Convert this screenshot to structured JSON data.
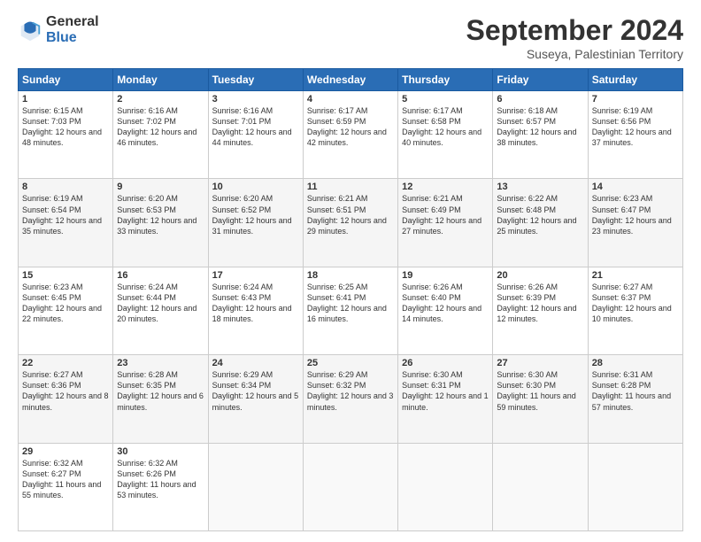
{
  "header": {
    "logo_general": "General",
    "logo_blue": "Blue",
    "month_title": "September 2024",
    "subtitle": "Suseya, Palestinian Territory"
  },
  "weekdays": [
    "Sunday",
    "Monday",
    "Tuesday",
    "Wednesday",
    "Thursday",
    "Friday",
    "Saturday"
  ],
  "weeks": [
    [
      {
        "day": "1",
        "sunrise": "6:15 AM",
        "sunset": "7:03 PM",
        "daylight": "12 hours and 48 minutes."
      },
      {
        "day": "2",
        "sunrise": "6:16 AM",
        "sunset": "7:02 PM",
        "daylight": "12 hours and 46 minutes."
      },
      {
        "day": "3",
        "sunrise": "6:16 AM",
        "sunset": "7:01 PM",
        "daylight": "12 hours and 44 minutes."
      },
      {
        "day": "4",
        "sunrise": "6:17 AM",
        "sunset": "6:59 PM",
        "daylight": "12 hours and 42 minutes."
      },
      {
        "day": "5",
        "sunrise": "6:17 AM",
        "sunset": "6:58 PM",
        "daylight": "12 hours and 40 minutes."
      },
      {
        "day": "6",
        "sunrise": "6:18 AM",
        "sunset": "6:57 PM",
        "daylight": "12 hours and 38 minutes."
      },
      {
        "day": "7",
        "sunrise": "6:19 AM",
        "sunset": "6:56 PM",
        "daylight": "12 hours and 37 minutes."
      }
    ],
    [
      {
        "day": "8",
        "sunrise": "6:19 AM",
        "sunset": "6:54 PM",
        "daylight": "12 hours and 35 minutes."
      },
      {
        "day": "9",
        "sunrise": "6:20 AM",
        "sunset": "6:53 PM",
        "daylight": "12 hours and 33 minutes."
      },
      {
        "day": "10",
        "sunrise": "6:20 AM",
        "sunset": "6:52 PM",
        "daylight": "12 hours and 31 minutes."
      },
      {
        "day": "11",
        "sunrise": "6:21 AM",
        "sunset": "6:51 PM",
        "daylight": "12 hours and 29 minutes."
      },
      {
        "day": "12",
        "sunrise": "6:21 AM",
        "sunset": "6:49 PM",
        "daylight": "12 hours and 27 minutes."
      },
      {
        "day": "13",
        "sunrise": "6:22 AM",
        "sunset": "6:48 PM",
        "daylight": "12 hours and 25 minutes."
      },
      {
        "day": "14",
        "sunrise": "6:23 AM",
        "sunset": "6:47 PM",
        "daylight": "12 hours and 23 minutes."
      }
    ],
    [
      {
        "day": "15",
        "sunrise": "6:23 AM",
        "sunset": "6:45 PM",
        "daylight": "12 hours and 22 minutes."
      },
      {
        "day": "16",
        "sunrise": "6:24 AM",
        "sunset": "6:44 PM",
        "daylight": "12 hours and 20 minutes."
      },
      {
        "day": "17",
        "sunrise": "6:24 AM",
        "sunset": "6:43 PM",
        "daylight": "12 hours and 18 minutes."
      },
      {
        "day": "18",
        "sunrise": "6:25 AM",
        "sunset": "6:41 PM",
        "daylight": "12 hours and 16 minutes."
      },
      {
        "day": "19",
        "sunrise": "6:26 AM",
        "sunset": "6:40 PM",
        "daylight": "12 hours and 14 minutes."
      },
      {
        "day": "20",
        "sunrise": "6:26 AM",
        "sunset": "6:39 PM",
        "daylight": "12 hours and 12 minutes."
      },
      {
        "day": "21",
        "sunrise": "6:27 AM",
        "sunset": "6:37 PM",
        "daylight": "12 hours and 10 minutes."
      }
    ],
    [
      {
        "day": "22",
        "sunrise": "6:27 AM",
        "sunset": "6:36 PM",
        "daylight": "12 hours and 8 minutes."
      },
      {
        "day": "23",
        "sunrise": "6:28 AM",
        "sunset": "6:35 PM",
        "daylight": "12 hours and 6 minutes."
      },
      {
        "day": "24",
        "sunrise": "6:29 AM",
        "sunset": "6:34 PM",
        "daylight": "12 hours and 5 minutes."
      },
      {
        "day": "25",
        "sunrise": "6:29 AM",
        "sunset": "6:32 PM",
        "daylight": "12 hours and 3 minutes."
      },
      {
        "day": "26",
        "sunrise": "6:30 AM",
        "sunset": "6:31 PM",
        "daylight": "12 hours and 1 minute."
      },
      {
        "day": "27",
        "sunrise": "6:30 AM",
        "sunset": "6:30 PM",
        "daylight": "11 hours and 59 minutes."
      },
      {
        "day": "28",
        "sunrise": "6:31 AM",
        "sunset": "6:28 PM",
        "daylight": "11 hours and 57 minutes."
      }
    ],
    [
      {
        "day": "29",
        "sunrise": "6:32 AM",
        "sunset": "6:27 PM",
        "daylight": "11 hours and 55 minutes."
      },
      {
        "day": "30",
        "sunrise": "6:32 AM",
        "sunset": "6:26 PM",
        "daylight": "11 hours and 53 minutes."
      },
      null,
      null,
      null,
      null,
      null
    ]
  ]
}
